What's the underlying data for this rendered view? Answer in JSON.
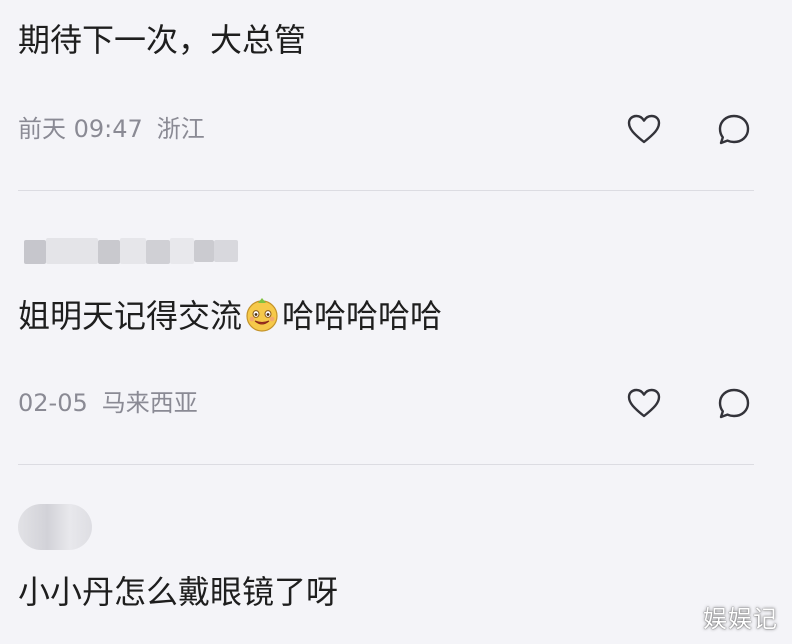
{
  "comments": [
    {
      "text": "期待下一次，大总管",
      "time": "前天 09:47",
      "location": "浙江"
    },
    {
      "text_before_emoji": "姐明天记得交流",
      "emoji": "grinning-face-emoji",
      "text_after_emoji": "哈哈哈哈哈",
      "time": "02-05",
      "location": "马来西亚"
    },
    {
      "text": "小小丹怎么戴眼镜了呀"
    }
  ],
  "icons": {
    "like": "heart-icon",
    "reply": "speech-bubble-icon"
  },
  "watermark": "娱娱记",
  "colors": {
    "background": "#f4f4f8",
    "meta_text": "#8a8a94",
    "divider": "#dcdce2",
    "emoji_face": "#f6c94a"
  }
}
